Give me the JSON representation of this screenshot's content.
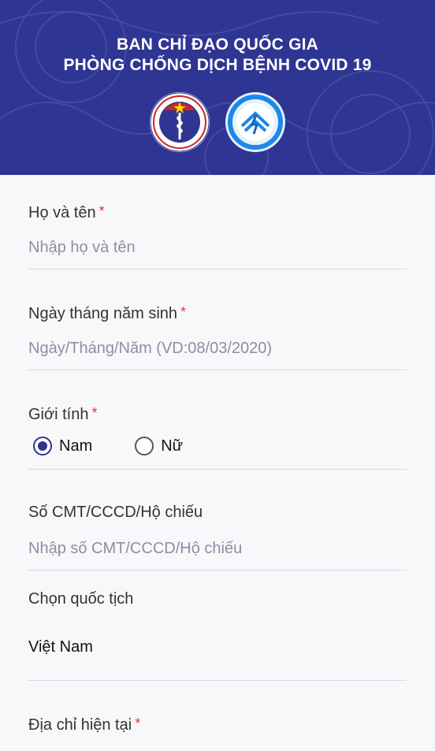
{
  "header": {
    "title_line1": "BAN CHỈ ĐẠO QUỐC GIA",
    "title_line2": "PHÒNG CHỐNG DỊCH BỆNH COVID 19",
    "logo_left": "ministry-of-health-logo",
    "logo_right": "ministry-of-information-logo",
    "bg_color": "#2f3592"
  },
  "form": {
    "full_name": {
      "label": "Họ và tên",
      "required": "*",
      "placeholder": "Nhập họ và tên"
    },
    "dob": {
      "label": "Ngày tháng năm sinh",
      "required": "*",
      "placeholder": "Ngày/Tháng/Năm (VD:08/03/2020)"
    },
    "gender": {
      "label": "Giới tính",
      "required": "*",
      "options": [
        {
          "label": "Nam",
          "selected": true
        },
        {
          "label": "Nữ",
          "selected": false
        }
      ]
    },
    "id_number": {
      "label": "Số CMT/CCCD/Hộ chiếu",
      "placeholder": "Nhập số CMT/CCCD/Hộ chiếu"
    },
    "nationality": {
      "label": "Chọn quốc tịch",
      "value": "Việt Nam"
    },
    "address": {
      "label": "Địa chỉ hiện tại",
      "required": "*"
    }
  },
  "colors": {
    "accent": "#2f3592",
    "required": "#e53935",
    "placeholder": "#8a8fa6"
  }
}
